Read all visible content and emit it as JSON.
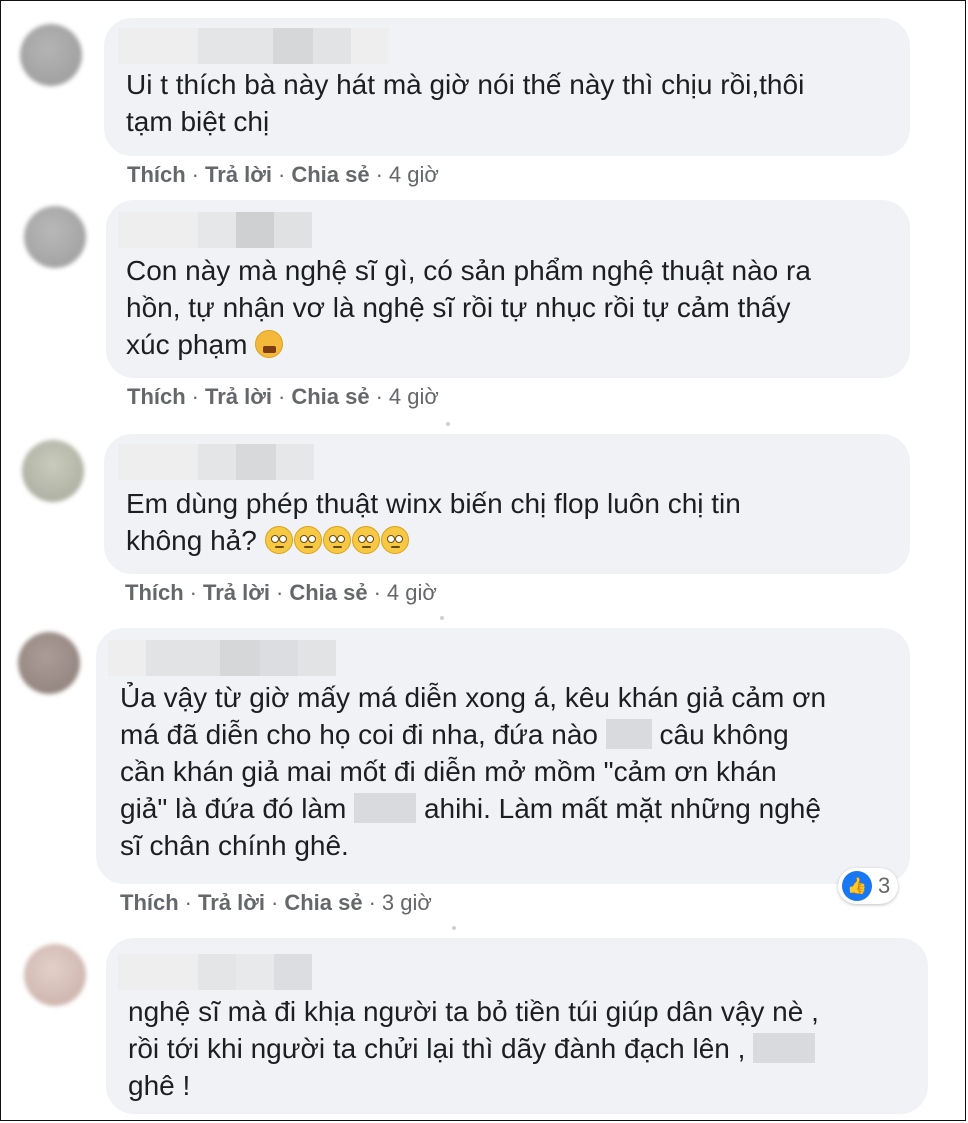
{
  "comments": [
    {
      "text_lines": [
        "Ui t thích bà này hát mà giờ nói thế này thì chịu rồi,thôi",
        "tạm biệt chị"
      ],
      "actions": {
        "like": "Thích",
        "reply": "Trả lời",
        "share": "Chia sẻ",
        "time": "4 giờ"
      }
    },
    {
      "text_lines": [
        "Con này mà nghệ sĩ gì, có sản phẩm nghệ thuật nào ra",
        "hồn, tự nhận vơ là nghệ sĩ rồi tự nhục rồi tự cảm thấy",
        "xúc phạm"
      ],
      "actions": {
        "like": "Thích",
        "reply": "Trả lời",
        "share": "Chia sẻ",
        "time": "4 giờ"
      }
    },
    {
      "text_lines": [
        "Em dùng phép thuật winx biến chị flop luôn chị tin",
        "không hả?"
      ],
      "actions": {
        "like": "Thích",
        "reply": "Trả lời",
        "share": "Chia sẻ",
        "time": "4 giờ"
      }
    },
    {
      "text_lines": [
        "Ủa vậy từ giờ mấy má diễn xong á, kêu khán giả cảm ơn",
        "má đã diễn cho họ coi đi nha, đứa nào",
        "câu không",
        "cần khán giả mai mốt đi diễn mở mồm \"cảm ơn khán",
        "giả\" là đứa đó làm",
        "ahihi. Làm mất mặt những nghệ",
        "sĩ chân chính ghê."
      ],
      "actions": {
        "like": "Thích",
        "reply": "Trả lời",
        "share": "Chia sẻ",
        "time": "3 giờ"
      },
      "reaction_count": "3"
    },
    {
      "text_lines": [
        "nghệ sĩ mà đi khịa người ta bỏ tiền túi giúp dân vậy nè ,",
        "rồi tới khi người ta chửi lại thì dãy đành đạch lên ,",
        "ghê !"
      ]
    }
  ],
  "colors": {
    "bubble": "#f0f2f5",
    "text": "#1c1e21",
    "meta": "#65676b",
    "like": "#1877f2"
  }
}
